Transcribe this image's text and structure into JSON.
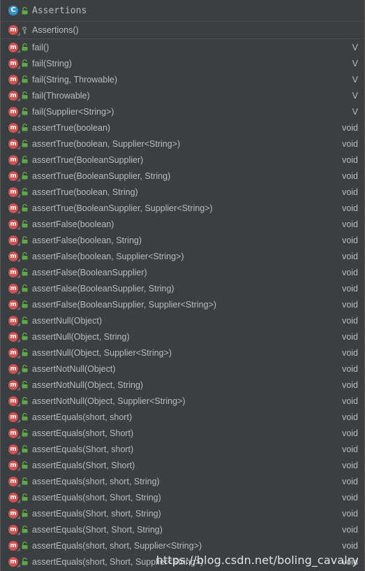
{
  "header": {
    "class_badge": "C",
    "class_icon": "class-icon",
    "access_icon": "unlock-icon",
    "title": "Assertions"
  },
  "constructor": {
    "badge": "m",
    "access_icon": "key-icon",
    "label": "Assertions()"
  },
  "members": [
    {
      "badge": "m",
      "label": "fail()",
      "type": "V"
    },
    {
      "badge": "m",
      "label": "fail(String)",
      "type": "V"
    },
    {
      "badge": "m",
      "label": "fail(String, Throwable)",
      "type": "V"
    },
    {
      "badge": "m",
      "label": "fail(Throwable)",
      "type": "V"
    },
    {
      "badge": "m",
      "label": "fail(Supplier<String>)",
      "type": "V"
    },
    {
      "badge": "m",
      "label": "assertTrue(boolean)",
      "type": "void"
    },
    {
      "badge": "m",
      "label": "assertTrue(boolean, Supplier<String>)",
      "type": "void"
    },
    {
      "badge": "m",
      "label": "assertTrue(BooleanSupplier)",
      "type": "void"
    },
    {
      "badge": "m",
      "label": "assertTrue(BooleanSupplier, String)",
      "type": "void"
    },
    {
      "badge": "m",
      "label": "assertTrue(boolean, String)",
      "type": "void"
    },
    {
      "badge": "m",
      "label": "assertTrue(BooleanSupplier, Supplier<String>)",
      "type": "void"
    },
    {
      "badge": "m",
      "label": "assertFalse(boolean)",
      "type": "void"
    },
    {
      "badge": "m",
      "label": "assertFalse(boolean, String)",
      "type": "void"
    },
    {
      "badge": "m",
      "label": "assertFalse(boolean, Supplier<String>)",
      "type": "void"
    },
    {
      "badge": "m",
      "label": "assertFalse(BooleanSupplier)",
      "type": "void"
    },
    {
      "badge": "m",
      "label": "assertFalse(BooleanSupplier, String)",
      "type": "void"
    },
    {
      "badge": "m",
      "label": "assertFalse(BooleanSupplier, Supplier<String>)",
      "type": "void"
    },
    {
      "badge": "m",
      "label": "assertNull(Object)",
      "type": "void"
    },
    {
      "badge": "m",
      "label": "assertNull(Object, String)",
      "type": "void"
    },
    {
      "badge": "m",
      "label": "assertNull(Object, Supplier<String>)",
      "type": "void"
    },
    {
      "badge": "m",
      "label": "assertNotNull(Object)",
      "type": "void"
    },
    {
      "badge": "m",
      "label": "assertNotNull(Object, String)",
      "type": "void"
    },
    {
      "badge": "m",
      "label": "assertNotNull(Object, Supplier<String>)",
      "type": "void"
    },
    {
      "badge": "m",
      "label": "assertEquals(short, short)",
      "type": "void"
    },
    {
      "badge": "m",
      "label": "assertEquals(short, Short)",
      "type": "void"
    },
    {
      "badge": "m",
      "label": "assertEquals(Short, short)",
      "type": "void"
    },
    {
      "badge": "m",
      "label": "assertEquals(Short, Short)",
      "type": "void"
    },
    {
      "badge": "m",
      "label": "assertEquals(short, short, String)",
      "type": "void"
    },
    {
      "badge": "m",
      "label": "assertEquals(short, Short, String)",
      "type": "void"
    },
    {
      "badge": "m",
      "label": "assertEquals(Short, short, String)",
      "type": "void"
    },
    {
      "badge": "m",
      "label": "assertEquals(Short, Short, String)",
      "type": "void"
    },
    {
      "badge": "m",
      "label": "assertEquals(short, short, Supplier<String>)",
      "type": "void"
    },
    {
      "badge": "m",
      "label": "assertEquals(short, Short, Supplier<String>)",
      "type": "void"
    }
  ],
  "member_icons": {
    "method_icon": "method-icon",
    "access_icon": "unlock-icon"
  },
  "watermark": "https://blog.csdn.net/boling_cavalry",
  "colors": {
    "background": "#3c3f41",
    "text": "#bbbbbb",
    "method_badge": "#d25252",
    "class_badge": "#3592c4",
    "public_access": "#5ea84a"
  }
}
